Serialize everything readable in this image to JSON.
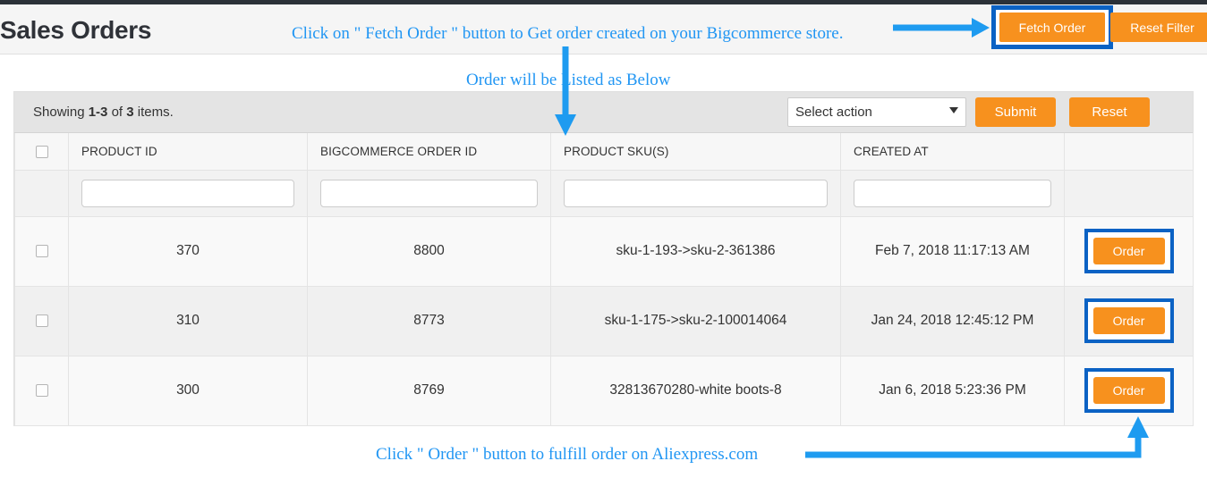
{
  "page": {
    "title": "Sales Orders"
  },
  "header": {
    "fetch_order_label": "Fetch Order",
    "reset_filter_label": "Reset Filter"
  },
  "toolbar": {
    "showing_prefix": "Showing ",
    "showing_range": "1-3",
    "showing_middle": " of ",
    "showing_total": "3",
    "showing_suffix": " items.",
    "select_action_value": "Select action",
    "select_action_options": [
      "Select action"
    ],
    "submit_label": "Submit",
    "reset_label": "Reset"
  },
  "table": {
    "columns": [
      {
        "key": "check",
        "label": ""
      },
      {
        "key": "product_id",
        "label": "PRODUCT ID"
      },
      {
        "key": "bigcommerce_order_id",
        "label": "BIGCOMMERCE ORDER ID"
      },
      {
        "key": "product_skus",
        "label": "PRODUCT SKU(S)"
      },
      {
        "key": "created_at",
        "label": "CREATED AT"
      },
      {
        "key": "action",
        "label": ""
      }
    ],
    "filters": {
      "product_id": "",
      "bigcommerce_order_id": "",
      "product_skus": "",
      "created_at": ""
    },
    "rows": [
      {
        "product_id": "370",
        "bigcommerce_order_id": "8800",
        "product_skus": "sku-1-193->sku-2-361386",
        "created_at": "Feb 7, 2018 11:17:13 AM",
        "action_label": "Order"
      },
      {
        "product_id": "310",
        "bigcommerce_order_id": "8773",
        "product_skus": "sku-1-175->sku-2-100014064",
        "created_at": "Jan 24, 2018 12:45:12 PM",
        "action_label": "Order"
      },
      {
        "product_id": "300",
        "bigcommerce_order_id": "8769",
        "product_skus": "32813670280-white boots-8",
        "created_at": "Jan 6, 2018 5:23:36 PM",
        "action_label": "Order"
      }
    ]
  },
  "annotations": {
    "top": "Click on \" Fetch Order \" button to Get order created on your Bigcommerce store.",
    "middle": "Order will be Listed as Below",
    "bottom": "Click \" Order \" button to fulfill order on Aliexpress.com"
  },
  "colors": {
    "accent_orange": "#f7911e",
    "annotation_blue": "#2196f3",
    "highlight_blue": "#0b62c4",
    "navbar_dark": "#2b3138"
  }
}
